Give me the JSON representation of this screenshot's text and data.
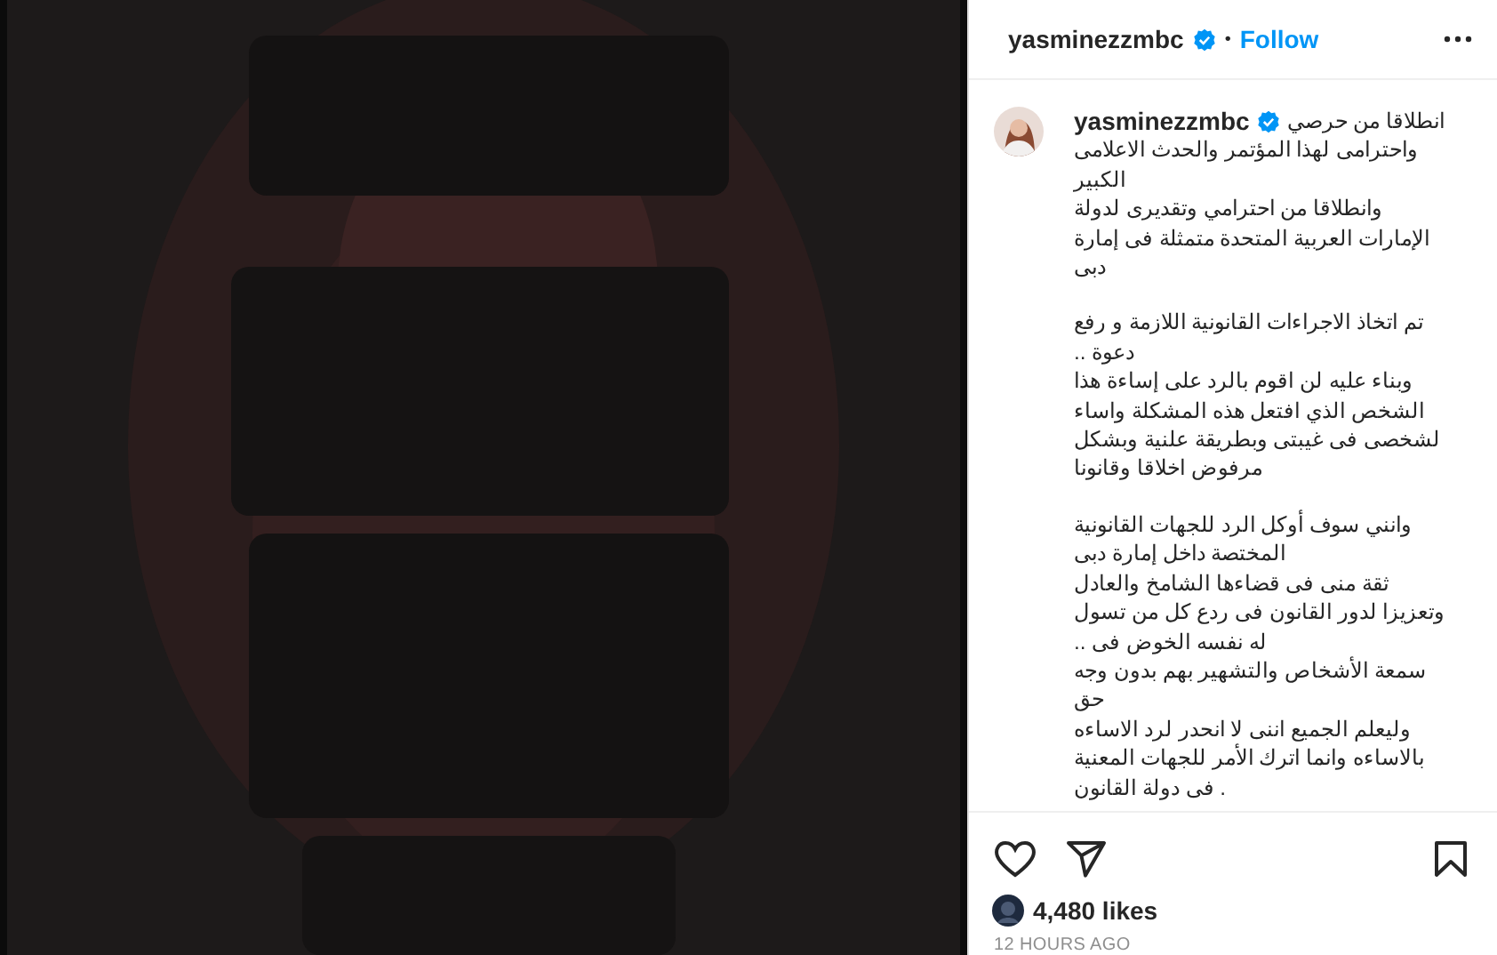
{
  "header": {
    "username": "yasminezzmbc",
    "verified": true,
    "separator": "•",
    "follow": "Follow"
  },
  "caption": {
    "username": "yasminezzmbc",
    "verified": true,
    "paragraphs": [
      [
        "انطلاقا من حرصي",
        "واحترامى لهذا المؤتمر والحدث الاعلامى",
        "الكبير",
        "وانطلاقا من احترامي وتقديرى لدولة",
        "الإمارات العربية المتحدة متمثلة فى إمارة",
        "دبى"
      ],
      [
        "تم اتخاذ الاجراءات القانونية اللازمة و رفع",
        ".. دعوة",
        "وبناء عليه لن اقوم بالرد على إساءة هذا",
        "الشخص الذي افتعل هذه المشكلة واساء",
        "لشخصى فى غيبتى وبطريقة علنية وبشكل",
        "مرفوض اخلاقا وقانونا"
      ],
      [
        "وانني سوف أوكل الرد للجهات القانونية",
        "المختصة داخل إمارة دبى",
        "ثقة منى فى قضاءها الشامخ والعادل",
        "وتعزيزا لدور القانون فى ردع كل من تسول",
        ".. له نفسه الخوض فى",
        "سمعة الأشخاص والتشهير بهم بدون وجه",
        "حق",
        "وليعلم الجميع اننى لا انحدر لرد الاساءه",
        "بالاساءه وانما اترك الأمر للجهات المعنية",
        "فى دولة القانون ."
      ]
    ]
  },
  "likes": "4,480 likes",
  "time": "12 HOURS AGO"
}
